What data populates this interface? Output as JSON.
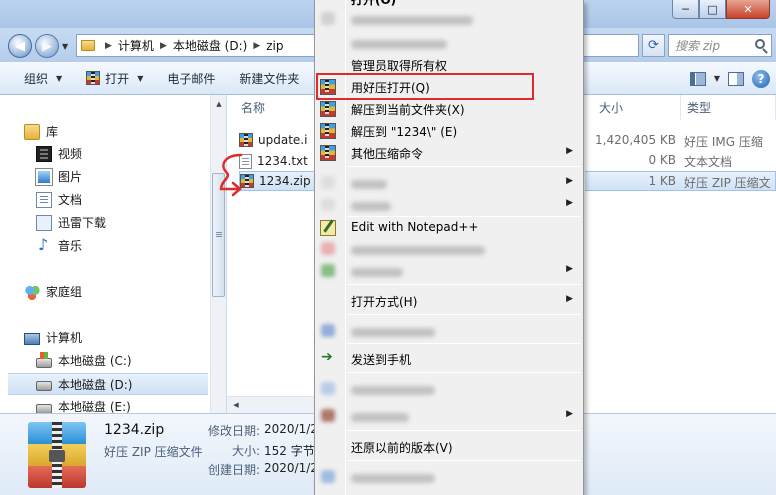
{
  "window": {
    "min_glyph": "─",
    "max_glyph": "□",
    "close_glyph": "✕"
  },
  "address": {
    "crumbs": [
      "计算机",
      "本地磁盘 (D:)",
      "zip"
    ],
    "search_placeholder": "搜索 zip"
  },
  "toolbar": {
    "organize": "组织",
    "open": "打开",
    "email": "电子邮件",
    "new_folder": "新建文件夹"
  },
  "nav": {
    "library": "库",
    "video": "视频",
    "pictures": "图片",
    "documents": "文档",
    "xunlei": "迅雷下载",
    "music": "音乐",
    "homegroup": "家庭组",
    "computer": "计算机",
    "drive_c": "本地磁盘 (C:)",
    "drive_d": "本地磁盘 (D:)",
    "drive_e": "本地磁盘 (E:)"
  },
  "columns": {
    "name": "名称",
    "size": "大小",
    "type": "类型"
  },
  "files": [
    {
      "name": "update.i",
      "size": "1,420,405 KB",
      "type": "好压 IMG 压缩"
    },
    {
      "name": "1234.txt",
      "size": "0 KB",
      "type": "文本文档"
    },
    {
      "name": "1234.zip",
      "size": "1 KB",
      "type": "好压 ZIP 压缩文"
    }
  ],
  "details": {
    "name": "1234.zip",
    "type": "好压 ZIP 压缩文件",
    "modified_label": "修改日期:",
    "modified_value": "2020/1/2",
    "size_label": "大小:",
    "size_value": "152 字节",
    "created_label": "创建日期:",
    "created_value": "2020/1/2"
  },
  "context_menu": {
    "open": "打开(O)",
    "take_ownership": "管理员取得所有权",
    "open_with_haozip": "用好压打开(Q)",
    "extract_here": "解压到当前文件夹(X)",
    "extract_to": "解压到 \"1234\\\" (E)",
    "other_commands": "其他压缩命令",
    "edit_notepad": "Edit with Notepad++",
    "open_with": "打开方式(H)",
    "send_to_phone": "发送到手机",
    "restore_versions": "还原以前的版本(V)"
  },
  "colors": {
    "highlight_box": "#e12a2a",
    "annotation_stroke": "#e12a2a"
  }
}
